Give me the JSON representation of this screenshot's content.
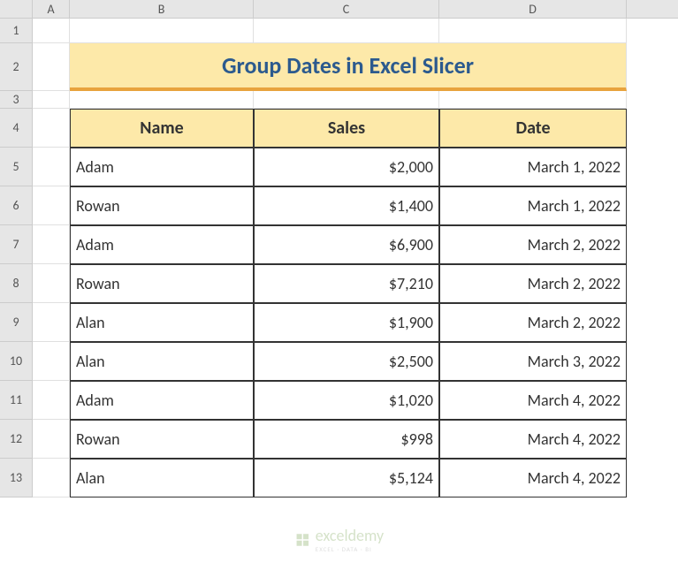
{
  "columns": [
    "A",
    "B",
    "C",
    "D"
  ],
  "rowNumbers": [
    "1",
    "2",
    "3",
    "4",
    "5",
    "6",
    "7",
    "8",
    "9",
    "10",
    "11",
    "12",
    "13"
  ],
  "title": "Group Dates in Excel Slicer",
  "headers": {
    "name": "Name",
    "sales": "Sales",
    "date": "Date"
  },
  "rows": [
    {
      "name": "Adam",
      "sales": "$2,000",
      "date": "March 1, 2022"
    },
    {
      "name": "Rowan",
      "sales": "$1,400",
      "date": "March 1, 2022"
    },
    {
      "name": "Adam",
      "sales": "$6,900",
      "date": "March 2, 2022"
    },
    {
      "name": "Rowan",
      "sales": "$7,210",
      "date": "March 2, 2022"
    },
    {
      "name": "Alan",
      "sales": "$1,900",
      "date": "March 2, 2022"
    },
    {
      "name": "Alan",
      "sales": "$2,500",
      "date": "March 3, 2022"
    },
    {
      "name": "Adam",
      "sales": "$1,020",
      "date": "March 4, 2022"
    },
    {
      "name": "Rowan",
      "sales": "$998",
      "date": "March 4, 2022"
    },
    {
      "name": "Alan",
      "sales": "$5,124",
      "date": "March 4, 2022"
    }
  ],
  "watermark": {
    "brand": "exceldemy",
    "tagline": "EXCEL · DATA · BI"
  },
  "colWidths": {
    "A": 42,
    "B": 208,
    "C": 210,
    "D": 212
  },
  "rowHeights": {
    "default": 44,
    "r1": 28,
    "r2": 54,
    "r3": 20
  }
}
